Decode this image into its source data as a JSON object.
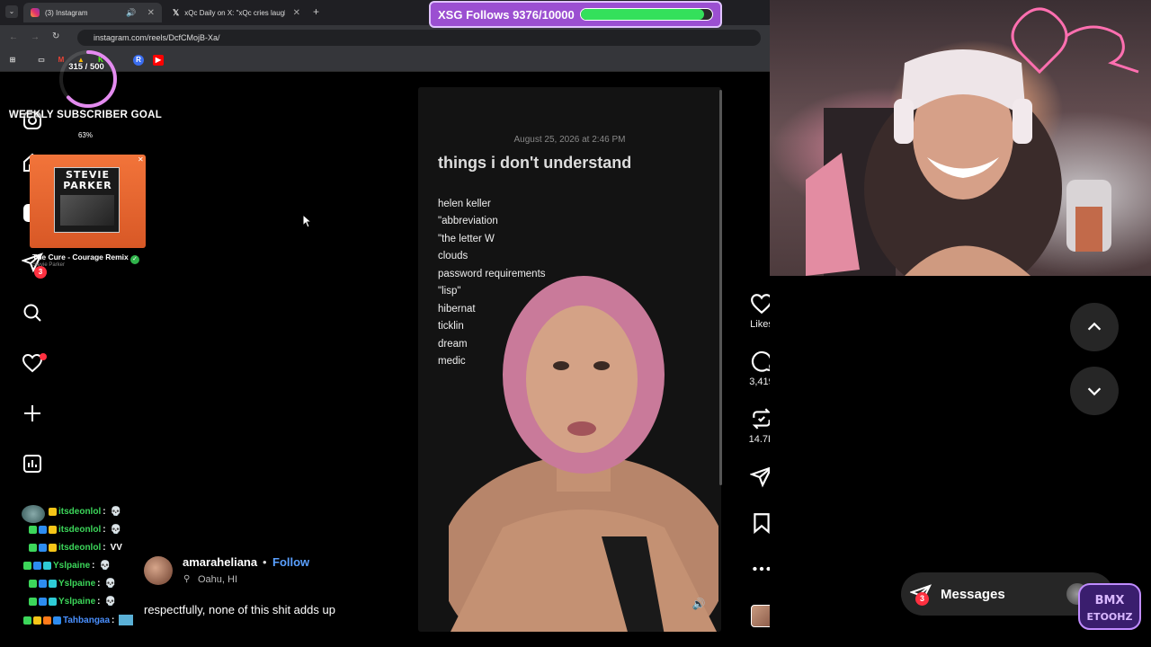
{
  "browser": {
    "tabs": [
      {
        "label": "(3) Instagram",
        "active": true
      },
      {
        "label": "xQc Daily on X: \"xQc cries laugh",
        "active": false
      }
    ],
    "url": "instagram.com/reels/DcfCMojB-Xa/"
  },
  "overlays": {
    "subscriber_goal_title": "WEEKLY SUBSCRIBER GOAL",
    "subscriber_goal_percent": "63%",
    "ring_text": "315 / 500",
    "ring_progress": 0.63,
    "follow_goal_label": "XSG Follows 9376/10000",
    "follow_goal_progress": 0.9376,
    "now_playing": {
      "album_title": "STEVIE PARKER",
      "song": "The Cure - Courage Remix",
      "artist": "Stevie Parker"
    }
  },
  "nav": {
    "messages_badge": "3"
  },
  "reel": {
    "date": "August 25, 2026 at 2:46 PM",
    "title": "things i don't understand",
    "lines": [
      "helen keller",
      "\"abbreviation",
      "\"the letter W",
      "clouds",
      "password requirements",
      "\"lisp\"",
      "hibernat",
      "ticklin",
      "dream",
      "medic"
    ]
  },
  "actions": {
    "likes_label": "Likes",
    "comments_count": "3,419",
    "reposts_count": "14.7K"
  },
  "author": {
    "username": "amaraheliana",
    "separator": "•",
    "follow_label": "Follow",
    "location": "Oahu, HI",
    "caption": "respectfully, none of this shit adds up"
  },
  "chat": [
    {
      "user": "itsdeonlol",
      "message": "💀",
      "color": "#3cd65a"
    },
    {
      "user": "itsdeonlol",
      "message": "💀",
      "color": "#3cd65a"
    },
    {
      "user": "itsdeonlol",
      "message": "VV",
      "color": "#3cd65a"
    },
    {
      "user": "Yslpaine",
      "message": "💀",
      "color": "#3cd65a"
    },
    {
      "user": "Yslpaine",
      "message": "💀",
      "color": "#3cd65a"
    },
    {
      "user": "Yslpaine",
      "message": "💀",
      "color": "#3cd65a"
    },
    {
      "user": "Tahbangaa",
      "message": "",
      "color": "#4a90ff"
    }
  ],
  "messages_panel": {
    "label": "Messages",
    "badge": "3"
  },
  "logo_text": "BMX ETOOHZ",
  "colors": {
    "follow_blue": "#5aa0ff",
    "badge_red": "#ff3040",
    "goal_green": "#34e05b",
    "goal_purple": "#9b4fd1"
  }
}
